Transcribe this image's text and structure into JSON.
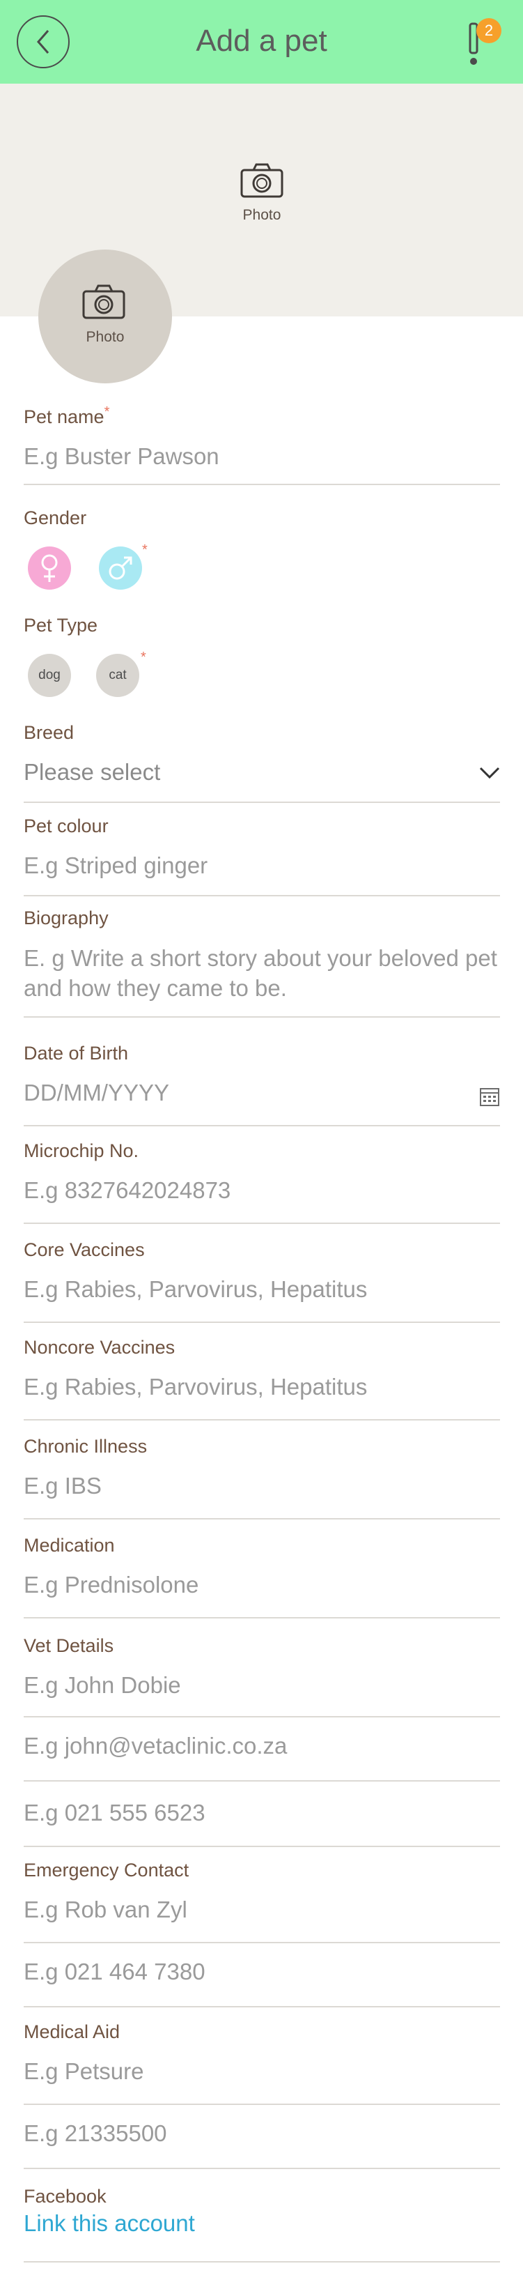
{
  "header": {
    "title": "Add a pet",
    "notification_count": "2"
  },
  "cover": {
    "photo_label": "Photo"
  },
  "avatar": {
    "photo_label": "Photo"
  },
  "form": {
    "pet_name": {
      "label": "Pet name",
      "placeholder": "E.g Buster Pawson"
    },
    "gender": {
      "label": "Gender",
      "options": [
        "female",
        "male"
      ]
    },
    "pet_type": {
      "label": "Pet Type",
      "options": [
        "dog",
        "cat"
      ]
    },
    "breed": {
      "label": "Breed",
      "value": "Please select"
    },
    "pet_colour": {
      "label": "Pet colour",
      "placeholder": "E.g Striped ginger"
    },
    "biography": {
      "label": "Biography",
      "placeholder": "E. g Write a short story about your beloved pet and how they came to be."
    },
    "date_of_birth": {
      "label": "Date of Birth",
      "placeholder": "DD/MM/YYYY"
    },
    "microchip": {
      "label": "Microchip No.",
      "placeholder": "E.g 8327642024873"
    },
    "core_vaccines": {
      "label": "Core Vaccines",
      "placeholder": "E.g Rabies, Parvovirus, Hepatitus"
    },
    "noncore_vaccines": {
      "label": "Noncore Vaccines",
      "placeholder": "E.g Rabies, Parvovirus, Hepatitus"
    },
    "chronic_illness": {
      "label": "Chronic Illness",
      "placeholder": "E.g IBS"
    },
    "medication": {
      "label": "Medication",
      "placeholder": "E.g Prednisolone"
    },
    "vet_details": {
      "label": "Vet Details",
      "name_placeholder": "E.g John Dobie",
      "email_placeholder": "E.g john@vetaclinic.co.za",
      "phone_placeholder": "E.g 021 555 6523"
    },
    "emergency_contact": {
      "label": "Emergency Contact",
      "name_placeholder": "E.g Rob van Zyl",
      "phone_placeholder": "E.g 021 464 7380"
    },
    "medical_aid": {
      "label": "Medical Aid",
      "name_placeholder": "E.g Petsure",
      "number_placeholder": "E.g 21335500"
    },
    "facebook": {
      "label": "Facebook",
      "link_text": "Link this account"
    }
  },
  "colors": {
    "header_bg": "#8ef3ab",
    "badge": "#f6a02b",
    "female": "#f7a9d5",
    "male": "#a9e9f3",
    "link": "#2ea7d2",
    "required": "#e9755f"
  },
  "icons": [
    "chevron-left-icon",
    "exclamation-icon",
    "camera-icon",
    "female-icon",
    "male-icon",
    "chevron-down-icon",
    "calendar-icon"
  ]
}
